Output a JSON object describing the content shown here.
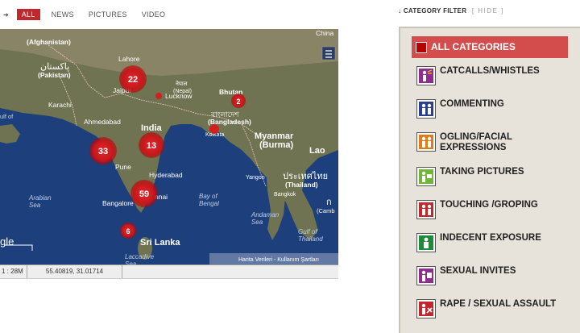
{
  "tabs": {
    "items": [
      "ALL",
      "NEWS",
      "PICTURES",
      "VIDEO"
    ]
  },
  "map": {
    "place_labels": {
      "china": "China",
      "afghanistan": "(Afghanistan)",
      "pakistan_native": "پاکستان",
      "pakistan": "(Pakistan)",
      "lahore": "Lahore",
      "karachi": "Karachi",
      "nepal_native": "नेपाल",
      "nepal": "(Nepal)",
      "lucknow": "Lucknow",
      "jaipur": "Jaipur",
      "bhutan": "Bhutan",
      "bangladesh_native": "বাংলাদেশ",
      "bangladesh": "(Bangladesh)",
      "kolkata": "Kolkata",
      "ahmedabad": "Ahmedabad",
      "india": "India",
      "pune": "Pune",
      "hyderabad": "Hyderabad",
      "bangalore": "Bangalore",
      "chennai": "nnai",
      "myanmar": "Myanmar",
      "burma": "(Burma)",
      "laos": "Lao",
      "thailand_native": "ประเทศไทย",
      "thailand": "(Thailand)",
      "yangon": "Yangon",
      "bangkok": "Bangkok",
      "cambodia_native": "ก",
      "cambodia": "(Camb",
      "arabian_sea": "Arabian\nSea",
      "bay_of_bengal": "Bay of\nBengal",
      "andaman_sea": "Andaman\nSea",
      "gulf_of_thailand": "Gulf of\nThailand",
      "gulf_left": "ulf of",
      "sri_lanka": "Sri Lanka",
      "laccadive_sea": "Laccadive\nSea",
      "google": "gle"
    },
    "clusters": [
      {
        "label": "22",
        "size": "large"
      },
      {
        "label": "2",
        "size": "small"
      },
      {
        "label": "13",
        "size": "large"
      },
      {
        "label": "33",
        "size": "large"
      },
      {
        "label": "59",
        "size": "large"
      },
      {
        "label": "6",
        "size": "small"
      }
    ],
    "attribution": "Harita Verileri - Kullanım Şartları"
  },
  "statusbar": {
    "scale": "1 : 28M",
    "coords": "55.40819, 31.01714"
  },
  "filter": {
    "title": "CATEGORY FILTER",
    "hide": "[ HIDE ]",
    "all_label": "ALL CATEGORIES",
    "categories": [
      {
        "label": "CATCALLS/WHISTLES",
        "icon": "catcalls-icon",
        "color": "#8e2d8e"
      },
      {
        "label": "COMMENTING",
        "icon": "commenting-icon",
        "color": "#2a3f8f"
      },
      {
        "label": "OGLING/FACIAL EXPRESSIONS",
        "icon": "ogling-icon",
        "color": "#e07b1a"
      },
      {
        "label": "TAKING PICTURES",
        "icon": "camera-icon",
        "color": "#6fb53a"
      },
      {
        "label": "TOUCHING /GROPING",
        "icon": "touching-icon",
        "color": "#c0282c"
      },
      {
        "label": "INDECENT EXPOSURE",
        "icon": "exposure-icon",
        "color": "#1e8a3a"
      },
      {
        "label": "SEXUAL INVITES",
        "icon": "invites-icon",
        "color": "#8e2d8e"
      },
      {
        "label": "RAPE / SEXUAL ASSAULT",
        "icon": "assault-icon",
        "color": "#c0282c"
      }
    ]
  },
  "colors": {
    "accent": "#c0282c",
    "panel_bg": "#e8e3da",
    "ocean": "#1c3c78",
    "land": "#7a7e5c"
  }
}
